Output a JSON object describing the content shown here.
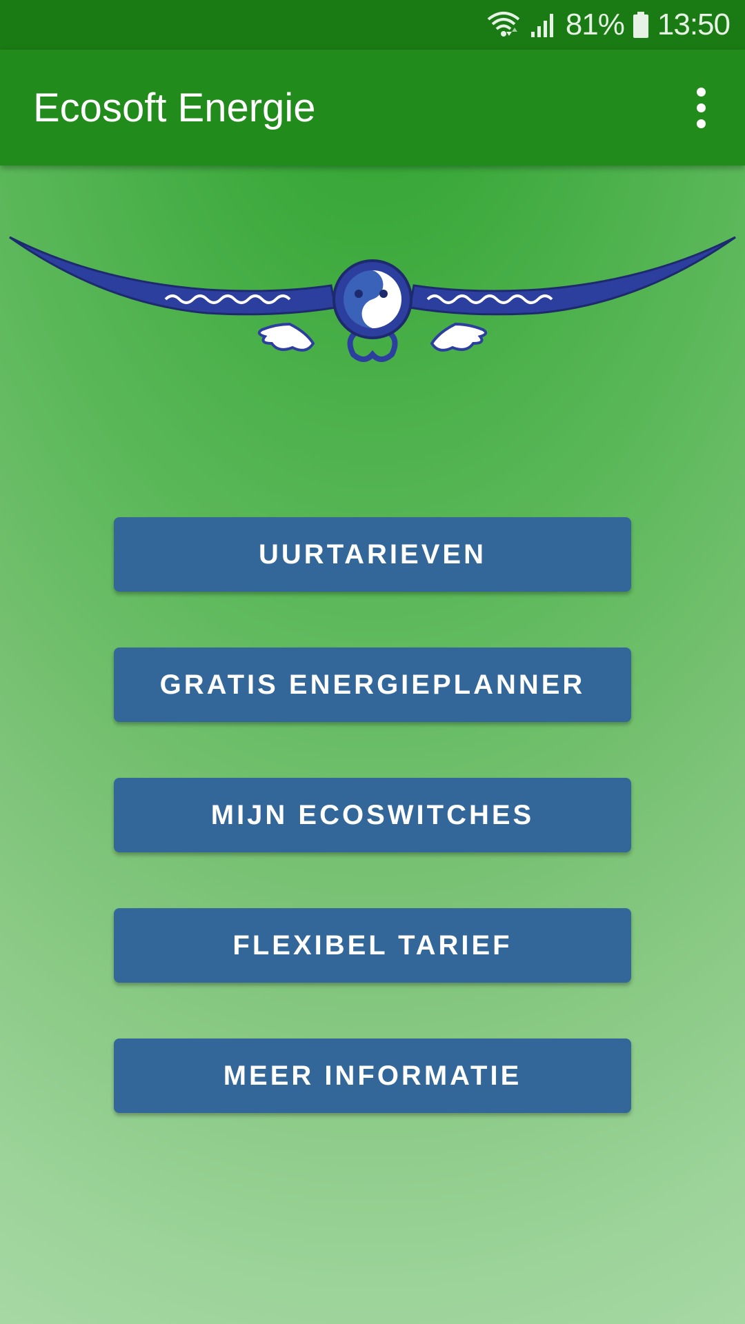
{
  "status_bar": {
    "wifi_icon": "wifi-icon",
    "signal_icon": "cell-signal-icon",
    "battery_percent": "81%",
    "battery_icon": "battery-icon",
    "time": "13:50"
  },
  "app_bar": {
    "title": "Ecosoft Energie",
    "menu_icon": "more-vert-icon"
  },
  "logo": {
    "icon": "owl-wings-logo"
  },
  "menu": {
    "buttons": [
      {
        "label": "UURTARIEVEN"
      },
      {
        "label": "GRATIS ENERGIEPLANNER"
      },
      {
        "label": "MIJN ECOSWITCHES"
      },
      {
        "label": "FLEXIBEL TARIEF"
      },
      {
        "label": "MEER INFORMATIE"
      }
    ]
  },
  "colors": {
    "status_bar": "#1a7a14",
    "app_bar": "#218c1b",
    "button": "#336699",
    "logo_blue": "#2c3f9e"
  }
}
